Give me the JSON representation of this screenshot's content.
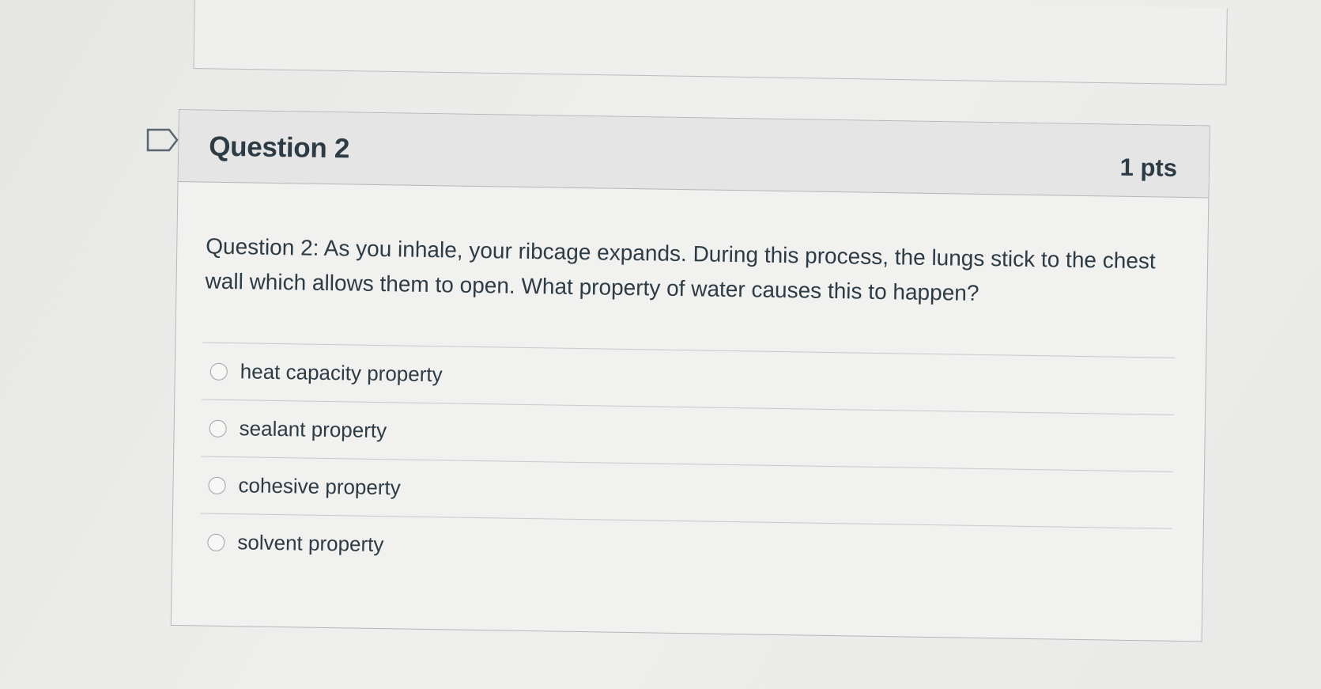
{
  "question": {
    "title": "Question 2",
    "points": "1 pts",
    "text": "Question 2: As you inhale, your ribcage expands. During this process, the lungs stick to the chest wall which allows them to open. What property of water causes this to happen?",
    "answers": [
      {
        "label": "heat capacity property",
        "selected": false
      },
      {
        "label": "sealant property",
        "selected": false
      },
      {
        "label": "cohesive property",
        "selected": false
      },
      {
        "label": "solvent property",
        "selected": false
      }
    ]
  },
  "icons": {
    "flag": "flag-icon",
    "radio": "radio-unselected-icon"
  },
  "colors": {
    "text": "#2d3b45",
    "header_bg": "#e4e5e4",
    "border": "#b3b8bb"
  }
}
